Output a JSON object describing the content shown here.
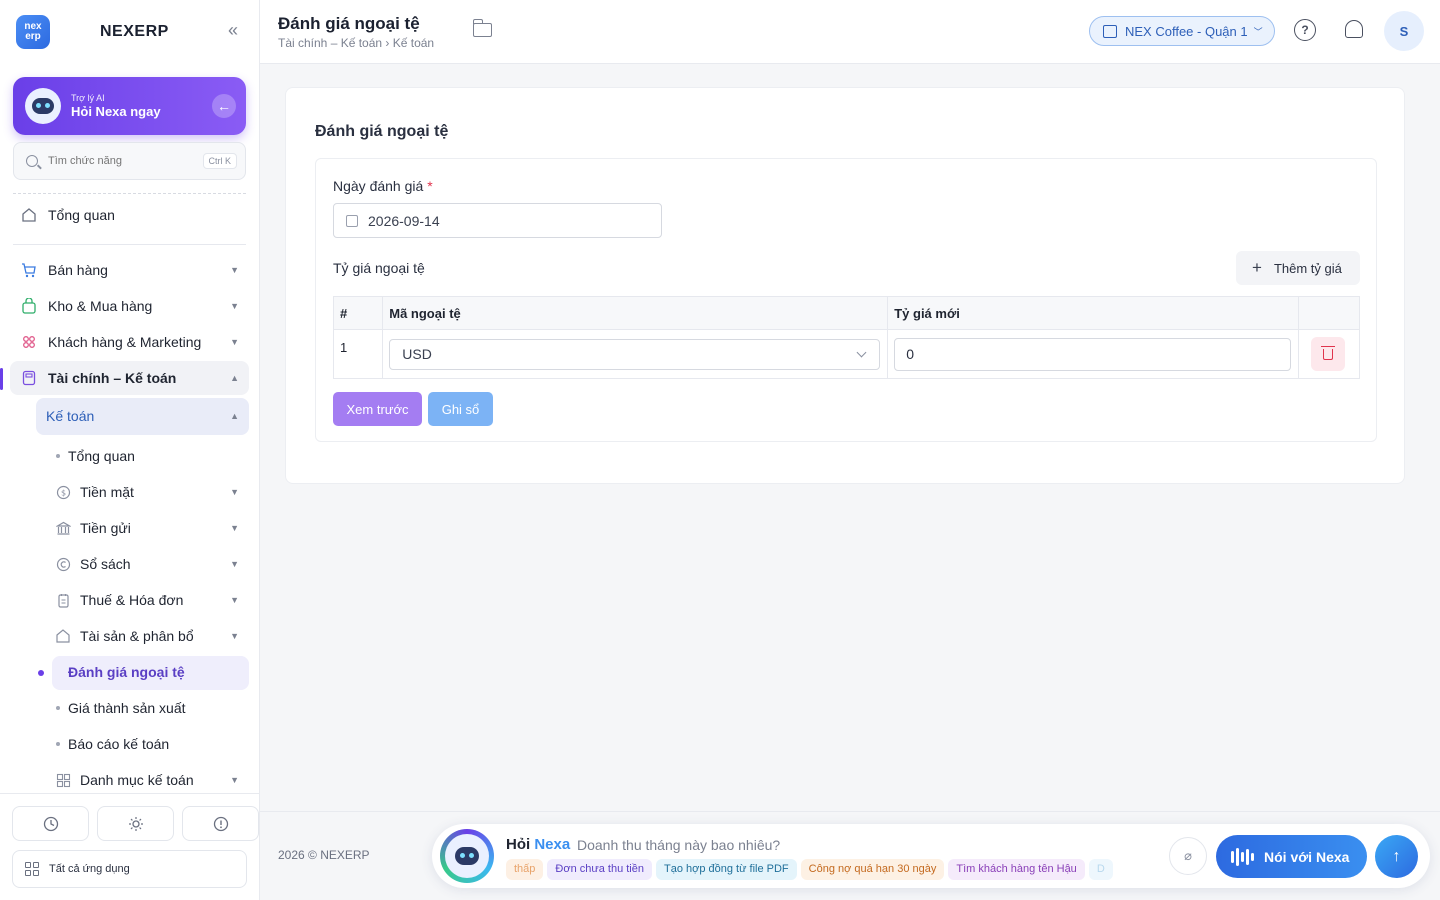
{
  "brand": {
    "logo_top": "nex",
    "logo_bottom": "erp",
    "name": "NEXERP"
  },
  "ai_card": {
    "subtitle": "Trợ lý AI",
    "title": "Hỏi Nexa ngay"
  },
  "search": {
    "placeholder": "Tìm chức năng",
    "shortcut": "Ctrl K"
  },
  "nav": {
    "overview": "Tổng quan",
    "sales": "Bán hàng",
    "inventory": "Kho & Mua hàng",
    "crm": "Khách hàng & Marketing",
    "finance": "Tài chính – Kế toán",
    "accounting": "Kế toán",
    "acc_items": {
      "overview": "Tổng quan",
      "cash": "Tiền mặt",
      "deposits": "Tiền gửi",
      "books": "Sổ sách",
      "tax": "Thuế & Hóa đơn",
      "assets": "Tài sản & phân bổ",
      "fx": "Đánh giá ngoại tệ",
      "costing": "Giá thành sản xuất",
      "reports": "Báo cáo kế toán",
      "catalog": "Danh mục kế toán"
    }
  },
  "sidebar_bottom": {
    "all_apps": "Tất cả ứng dụng"
  },
  "header": {
    "title": "Đánh giá ngoại tệ",
    "breadcrumb": "Tài chính – Kế toán › Kế toán",
    "store": "NEX Coffee - Quận 1",
    "help": "?",
    "avatar": "S"
  },
  "form": {
    "card_title": "Đánh giá ngoại tệ",
    "date_label": "Ngày đánh giá",
    "required_mark": "*",
    "date_value": "2026-09-14",
    "rates_label": "Tỷ giá ngoại tệ",
    "add_rate": "Thêm tỷ giá",
    "columns": [
      "#",
      "Mã ngoại tệ",
      "Tỷ giá mới",
      ""
    ],
    "rows": [
      {
        "index": "1",
        "currency": "USD",
        "rate": "0"
      }
    ],
    "preview_btn": "Xem trước",
    "post_btn": "Ghi sổ"
  },
  "footer": {
    "copyright": "2026 © NEXERP",
    "ask_prefix": "Hỏi ",
    "ask_brand": "Nexa",
    "ask_placeholder": "Doanh thu tháng này bao nhiêu?",
    "chips": [
      {
        "text": "thấp",
        "bg": "#fdf0e4",
        "fg": "#e8a36a"
      },
      {
        "text": "Đơn chưa thu tiền",
        "bg": "#f0ecfd",
        "fg": "#5a3fc4"
      },
      {
        "text": "Tạo hợp đồng từ file PDF",
        "bg": "#e4f4fb",
        "fg": "#1f6f9a"
      },
      {
        "text": "Công nợ quá hạn 30 ngày",
        "bg": "#fdf1e4",
        "fg": "#c46a1f"
      },
      {
        "text": "Tìm khách hàng tên Hậu",
        "bg": "#f5ebfb",
        "fg": "#8a3fb8"
      },
      {
        "text": "D",
        "bg": "#eef7fd",
        "fg": "#b8d8ee"
      }
    ],
    "voice_btn": "Nói với Nexa"
  },
  "colors": {
    "accent": "#6a3fe8",
    "primary": "#2d6ae0",
    "danger": "#e0344d"
  }
}
